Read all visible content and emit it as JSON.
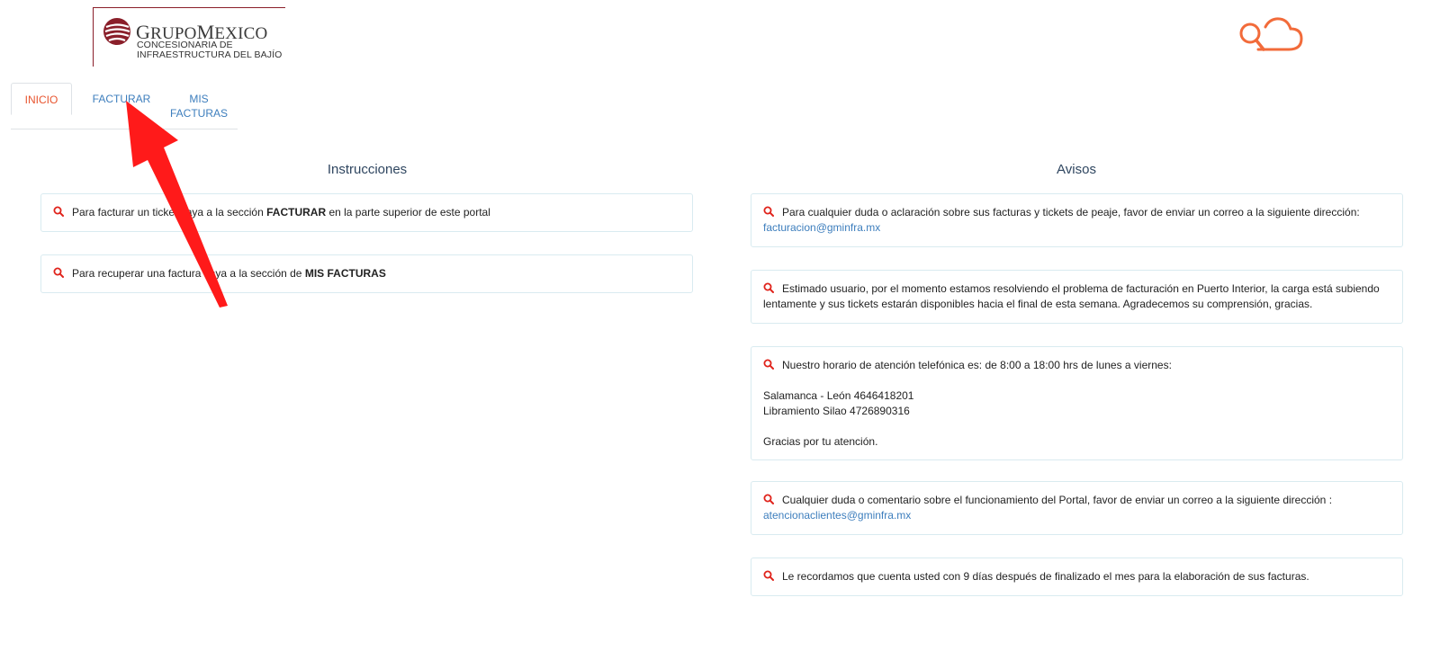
{
  "header": {
    "logo_title_first": "G",
    "logo_title_rest_a": "RUPO",
    "logo_title_m": "M",
    "logo_title_rest_b": "EXICO",
    "logo_sub_line1": "CONCESIONARIA DE",
    "logo_sub_line2": "INFRAESTRUCTURA DEL BAJÍO",
    "brand_color": "#8a1f2a",
    "cloud_icon": "cloud-search-icon",
    "cloud_color": "#f26b3a"
  },
  "tabs": [
    {
      "label": "INICIO"
    },
    {
      "label": "FACTURAR"
    },
    {
      "label_line1": "MIS",
      "label_line2": "FACTURAS"
    }
  ],
  "instrucciones": {
    "title": "Instrucciones",
    "items": [
      {
        "pre": "Para facturar un ticket vaya a la sección ",
        "bold": "FACTURAR",
        "post": " en la parte superior de este portal"
      },
      {
        "pre": "Para recuperar una factura vaya a la sección de ",
        "bold": "MIS FACTURAS",
        "post": ""
      }
    ]
  },
  "avisos": {
    "title": "Avisos",
    "items": [
      {
        "text": "Para cualquier duda o aclaración sobre sus facturas y tickets de peaje, favor de enviar un correo a la siguiente dirección:",
        "link": "facturacion@gminfra.mx"
      },
      {
        "text_line1": "Estimado usuario, por el momento estamos resolviendo el problema de facturación en Puerto Interior, la carga está subiendo",
        "text_line2": "lentamente y sus tickets estarán disponibles hacia el final de esta semana. Agradecemos su comprensión, gracias."
      },
      {
        "text": "Nuestro horario de atención telefónica es: de 8:00 a 18:00 hrs de lunes a viernes:",
        "phone1": "Salamanca - León 4646418201",
        "phone2": "Libramiento Silao 4726890316",
        "closing": "Gracias por tu atención."
      },
      {
        "text": "Cualquier duda o comentario sobre el funcionamiento del Portal, favor de enviar un correo a la siguiente dirección :",
        "link": "atencionaclientes@gminfra.mx"
      },
      {
        "text": "Le recordamos que cuenta usted con 9 días después de finalizado el mes para la elaboración de sus facturas."
      }
    ]
  },
  "colors": {
    "accent_orange": "#e8542e",
    "link_blue": "#3d7ebd",
    "search_icon_red": "#e0231b",
    "annotation_arrow_red": "#ff1a1a"
  }
}
